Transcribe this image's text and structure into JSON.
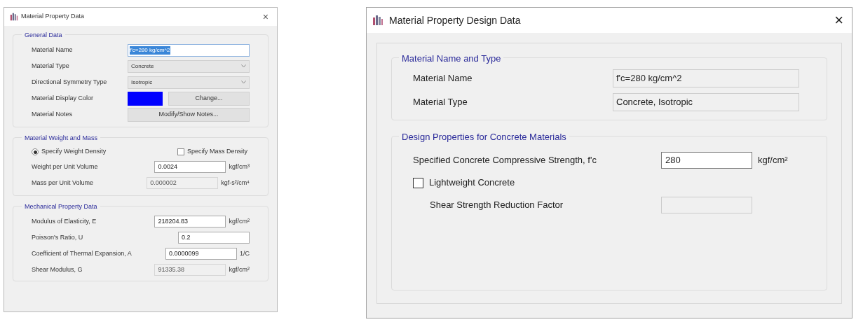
{
  "left_dialog": {
    "title": "Material Property Data",
    "close": "×",
    "general": {
      "title": "General Data",
      "rows": [
        {
          "kind": "name",
          "label": "Material Name",
          "value": "f'c=280 kg/cm^2"
        },
        {
          "kind": "dropdown",
          "label": "Material Type",
          "value": "Concrete"
        },
        {
          "kind": "dropdown",
          "label": "Directional Symmetry Type",
          "value": "Isotropic"
        },
        {
          "kind": "color",
          "label": "Material Display Color",
          "color": "#0000ff",
          "button": "Change..."
        },
        {
          "kind": "button",
          "label": "Material Notes",
          "button": "Modify/Show Notes..."
        }
      ]
    },
    "weight": {
      "title": "Material Weight and Mass",
      "options": [
        {
          "kind": "radio",
          "label": "Specify Weight Density",
          "selected": true
        },
        {
          "kind": "checkbox",
          "label": "Specify Mass Density",
          "selected": false
        }
      ],
      "rows": [
        {
          "label": "Weight per Unit Volume",
          "value": "0.0024",
          "unit": "kgf/cm³",
          "disabled": false
        },
        {
          "label": "Mass per Unit Volume",
          "value": "0.000002",
          "unit": "kgf-s²/cm⁴",
          "disabled": true
        }
      ]
    },
    "mechanical": {
      "title": "Mechanical Property Data",
      "rows": [
        {
          "label": "Modulus of Elasticity,  E",
          "value": "218204.83",
          "unit": "kgf/cm²",
          "disabled": false
        },
        {
          "label": "Poisson's Ratio,  U",
          "value": "0.2",
          "disabled": false
        },
        {
          "label": "Coefficient of Thermal Expansion,  A",
          "value": "0.0000099",
          "unit": "1/C",
          "disabled": false
        },
        {
          "label": "Shear Modulus,  G",
          "value": "91335.38",
          "unit": "kgf/cm²",
          "disabled": true
        }
      ]
    }
  },
  "right_dialog": {
    "title": "Material Property Design Data",
    "close": "×",
    "name_type": {
      "title": "Material Name and Type",
      "rows": [
        {
          "label": "Material Name",
          "value": "f'c=280 kg/cm^2"
        },
        {
          "label": "Material Type",
          "value": "Concrete, Isotropic"
        }
      ]
    },
    "design": {
      "title": "Design Properties for Concrete Materials",
      "rows": [
        {
          "kind": "field",
          "label": "Specified Concrete Compressive Strength, f'c",
          "value": "280",
          "unit": "kgf/cm²",
          "disabled": false
        },
        {
          "kind": "checkbox",
          "label": "Lightweight Concrete",
          "checked": false
        },
        {
          "kind": "field",
          "label": "Shear Strength Reduction Factor",
          "disabled": true
        }
      ]
    }
  }
}
